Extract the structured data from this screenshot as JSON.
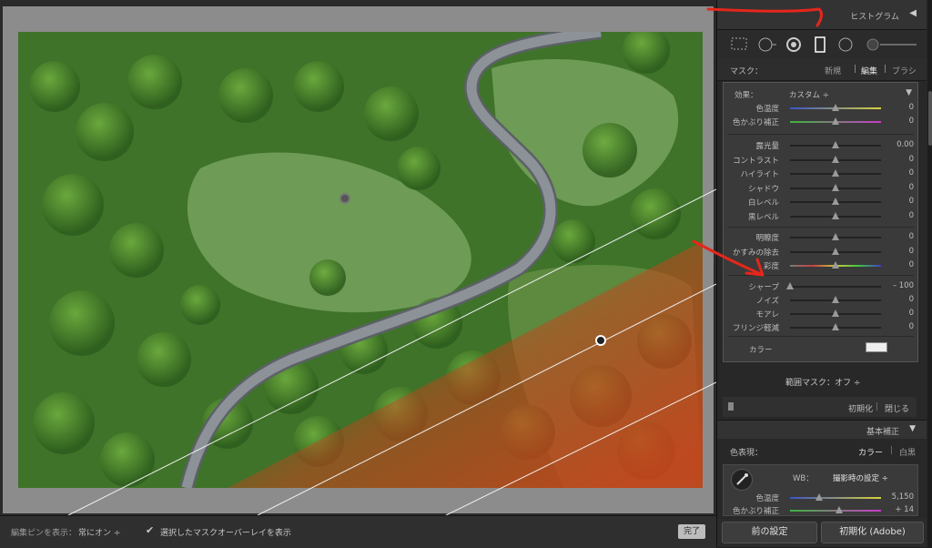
{
  "canvas": {
    "photo_description_colors": {
      "forest": "#3f7a2a",
      "meadow": "#6c9a52",
      "road": "#7e838a",
      "mask_overlay": "#c43a1a"
    }
  },
  "toolbar": {
    "show_pins_label": "編集ピンを表示：",
    "show_pins_value": "常にオン ÷",
    "overlay_checkbox": "✔",
    "overlay_label": "選択したマスクオーバーレイを表示",
    "done_label": "完了"
  },
  "panel": {
    "histogram_title": "ヒストグラム",
    "histogram_arrow": "◀",
    "tools": [
      "crop-icon",
      "spot-removal-icon",
      "red-eye-icon",
      "graduated-filter-icon",
      "radial-filter-icon",
      "adjustment-brush-icon"
    ],
    "mask": {
      "label": "マスク：",
      "new": "新規",
      "edit": "編集",
      "brush": "ブラシ"
    },
    "effect": {
      "label": "効果：",
      "value": "カスタム ÷",
      "menu": "▼"
    },
    "sliders_group1": [
      {
        "label": "色温度",
        "value": "0",
        "pos": 0.5,
        "track": "temp"
      },
      {
        "label": "色かぶり補正",
        "value": "0",
        "pos": 0.5,
        "track": "tint"
      }
    ],
    "sliders_group2": [
      {
        "label": "露光量",
        "value": "0.00",
        "pos": 0.5
      },
      {
        "label": "コントラスト",
        "value": "0",
        "pos": 0.5
      },
      {
        "label": "ハイライト",
        "value": "0",
        "pos": 0.5
      },
      {
        "label": "シャドウ",
        "value": "0",
        "pos": 0.5
      },
      {
        "label": "白レベル",
        "value": "0",
        "pos": 0.5
      },
      {
        "label": "黒レベル",
        "value": "0",
        "pos": 0.5
      }
    ],
    "sliders_group3": [
      {
        "label": "明瞭度",
        "value": "0",
        "pos": 0.5
      },
      {
        "label": "かすみの除去",
        "value": "0",
        "pos": 0.5
      },
      {
        "label": "彩度",
        "value": "0",
        "pos": 0.5,
        "track": "sat"
      }
    ],
    "sliders_group4": [
      {
        "label": "シャープ",
        "value": "– 100",
        "pos": 0.0
      },
      {
        "label": "ノイズ",
        "value": "0",
        "pos": 0.5
      },
      {
        "label": "モアレ",
        "value": "0",
        "pos": 0.5
      },
      {
        "label": "フリンジ軽減",
        "value": "0",
        "pos": 0.5
      }
    ],
    "color_label": "カラー",
    "range_mask": "範囲マスク：オフ ÷",
    "reset_label": "初期化",
    "close_label": "閉じる",
    "basic_title": "基本補正",
    "basic_arrow": "▼",
    "treatment_label": "色表現：",
    "treatment_color": "カラー",
    "treatment_bw": "白黒",
    "wb_label": "WB：",
    "wb_value": "撮影時の設定 ÷",
    "basic_sliders": [
      {
        "label": "色温度",
        "value": "5,150",
        "pos": 0.32,
        "track": "temp"
      },
      {
        "label": "色かぶり補正",
        "value": "+ 14",
        "pos": 0.54,
        "track": "tint"
      }
    ],
    "prev_button": "前の設定",
    "reset_adobe_button": "初期化 (Adobe)"
  }
}
